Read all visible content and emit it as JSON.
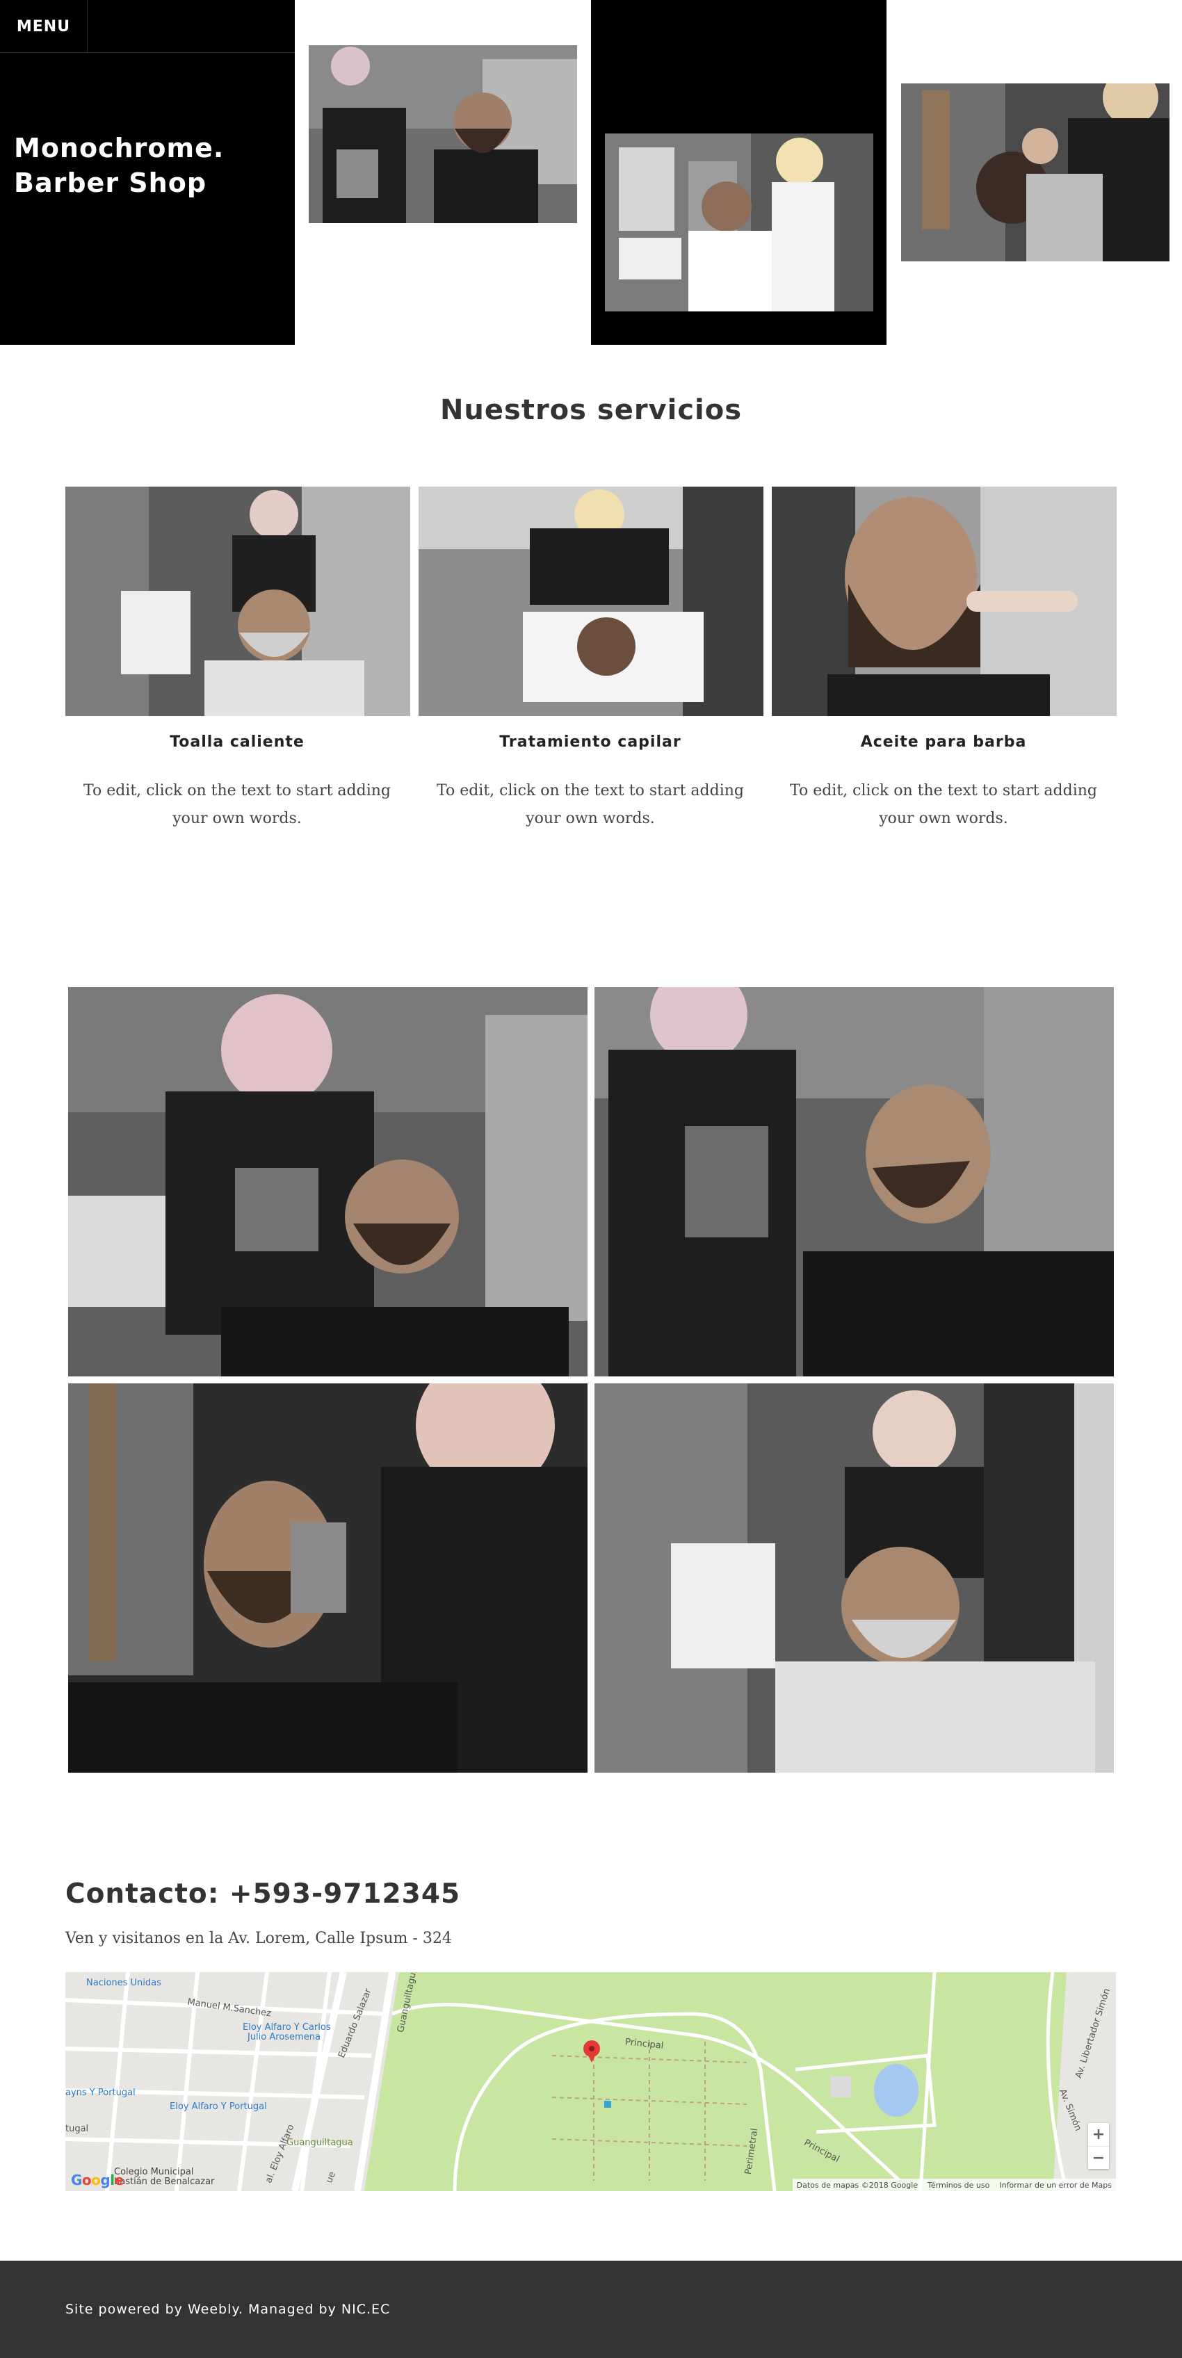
{
  "header": {
    "menu_label": "MENU",
    "site_title_line1": "Monochrome.",
    "site_title_line2": "Barber Shop"
  },
  "services": {
    "heading": "Nuestros servicios",
    "items": [
      {
        "title": "Toalla caliente",
        "text": "To edit, click on the text to start adding your own words."
      },
      {
        "title": "Tratamiento capilar",
        "text": "To edit, click on the text to start adding your own words."
      },
      {
        "title": "Aceite para barba",
        "text": "To edit, click on the text to start adding your own words."
      }
    ]
  },
  "contact": {
    "title": "Contacto: +593-9712345",
    "address": "Ven y visitanos en la Av. Lorem, Calle Ipsum - 324"
  },
  "map": {
    "labels": {
      "naciones": "Naciones Unidas",
      "manuel": "Manuel M.Sanchez",
      "eloy1": "Eloy Alfaro Y Carlos",
      "eloy1b": "Julio Arosemena",
      "eloy2": "Eloy Alfaro Y Portugal",
      "portugal1": "ayns Y Portugal",
      "portugal2": "tugal",
      "guanguiltagua": "Guanguiltagua",
      "eduardo": "Eduardo Salazar",
      "principal1": "Principal",
      "principal2": "Principal",
      "perimetral": "Perimetral",
      "libertador": "Av. Libertador Simón",
      "avsimon": "Av. Simón",
      "colegio1": "Colegio Municipal",
      "colegio2": "bastián de Benalcazar",
      "eloyalfaro": "al. Eloy Alfaro",
      "guanguiltagua2": "Guanguiltagua",
      "ue": "ue"
    },
    "zoom_in": "+",
    "zoom_out": "−",
    "footer": {
      "data": "Datos de mapas ©2018 Google",
      "terms": "Términos de uso",
      "report": "Informar de un error de Maps"
    },
    "logo": "Google"
  },
  "footer": {
    "text": "Site powered by Weebly. Managed by NIC.EC"
  },
  "colors": {
    "black": "#000000",
    "footer_bg": "#333333",
    "map_park": "#c9e5a2",
    "map_urban": "#e8e6e3",
    "pin": "#e53935"
  }
}
